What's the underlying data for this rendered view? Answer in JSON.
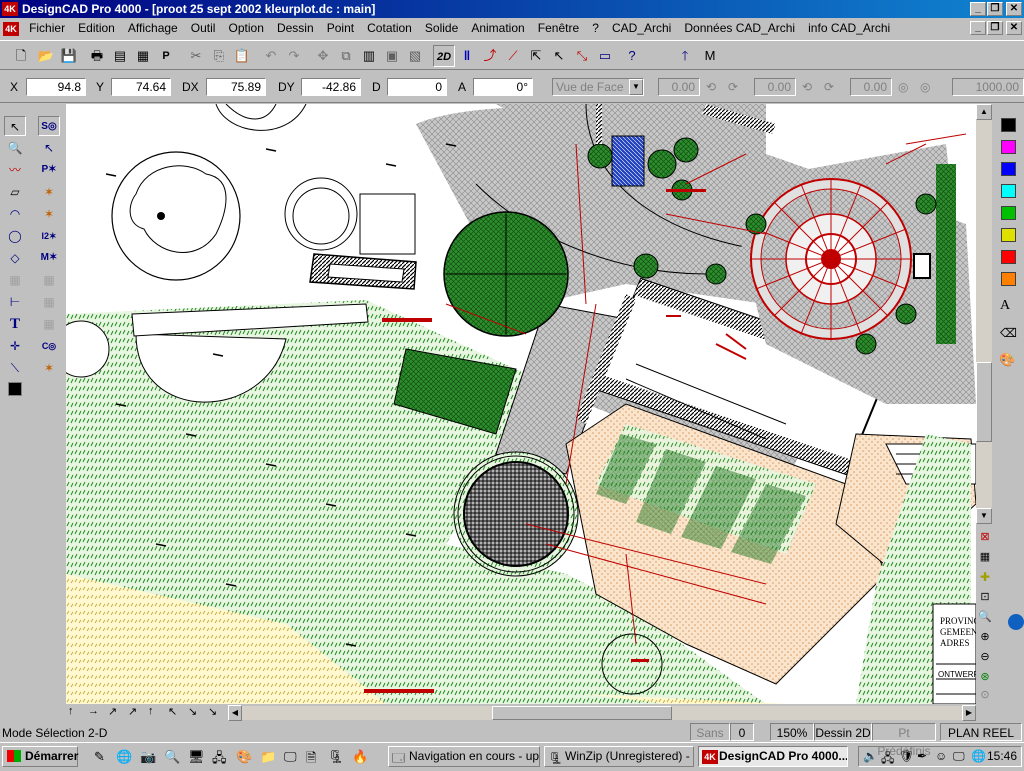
{
  "window": {
    "title": "DesignCAD Pro 4000 - [proot 25 sept 2002 kleurplot.dc : main]",
    "logo": "4K"
  },
  "menu": [
    "Fichier",
    "Edition",
    "Affichage",
    "Outil",
    "Option",
    "Dessin",
    "Point",
    "Cotation",
    "Solide",
    "Animation",
    "Fenêtre",
    "?",
    "CAD_Archi",
    "Données CAD_Archi",
    "info CAD_Archi"
  ],
  "toolbar": {
    "mode_2d": "2D",
    "truncated_label": "M"
  },
  "coords": {
    "x_label": "X",
    "x": "94.8",
    "y_label": "Y",
    "y": "74.64",
    "dx_label": "DX",
    "dx": "75.89",
    "dy_label": "DY",
    "dy": "-42.86",
    "d_label": "D",
    "d": "0",
    "a_label": "A",
    "a": "0°",
    "view": "Vue de Face",
    "v1": "0.00",
    "v2": "0.00",
    "v3": "0.00",
    "v4": "1000.00"
  },
  "legend": {
    "lines": [
      "PROVINC",
      "GEMEEN",
      "ADRES"
    ],
    "ontwerp": "ONTWERP"
  },
  "status": {
    "mode": "Mode Sélection 2-D",
    "font": "Sans",
    "layer": "0",
    "zoom": "150%",
    "draw_mode": "Dessin 2D",
    "predefined": "Pt Prédéfinis",
    "plan": "PLAN REEL"
  },
  "palette": [
    "#000000",
    "#ff00ff",
    "#0000ff",
    "#00ffff",
    "#00c000",
    "#e0e000",
    "#ff0000",
    "#ff8000"
  ],
  "taskbar": {
    "start": "Démarrer",
    "tasks": [
      "Navigation en cours - up...",
      "WinZip (Unregistered) - ...",
      "DesignCAD Pro 4000..."
    ],
    "clock": "15:46"
  }
}
